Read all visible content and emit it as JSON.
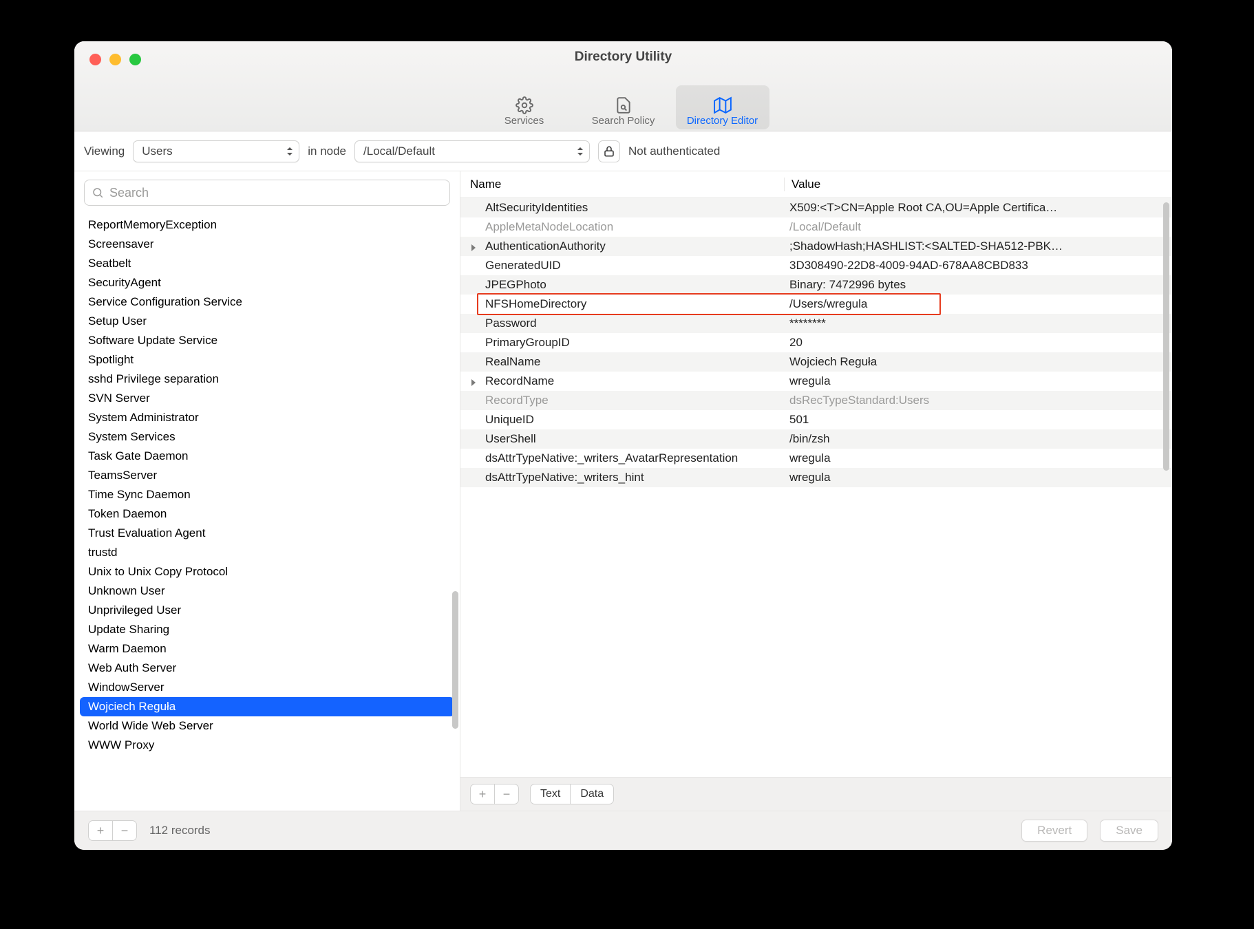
{
  "window_title": "Directory Utility",
  "toolbar": {
    "tabs": [
      {
        "label": "Services"
      },
      {
        "label": "Search Policy"
      },
      {
        "label": "Directory Editor",
        "active": true
      }
    ]
  },
  "filterbar": {
    "viewing_label": "Viewing",
    "viewing_value": "Users",
    "in_node_label": "in node",
    "in_node_value": "/Local/Default",
    "auth_status": "Not authenticated"
  },
  "search": {
    "placeholder": "Search"
  },
  "sidebar_items": [
    "ReportMemoryException",
    "Screensaver",
    "Seatbelt",
    "SecurityAgent",
    "Service Configuration Service",
    "Setup User",
    "Software Update Service",
    "Spotlight",
    "sshd Privilege separation",
    "SVN Server",
    "System Administrator",
    "System Services",
    "Task Gate Daemon",
    "TeamsServer",
    "Time Sync Daemon",
    "Token Daemon",
    "Trust Evaluation Agent",
    "trustd",
    "Unix to Unix Copy Protocol",
    "Unknown User",
    "Unprivileged User",
    "Update Sharing",
    "Warm Daemon",
    "Web Auth Server",
    "WindowServer",
    "Wojciech Reguła",
    "World Wide Web Server",
    "WWW Proxy"
  ],
  "sidebar_selected_index": 25,
  "table": {
    "header": {
      "name": "Name",
      "value": "Value"
    },
    "rows": [
      {
        "name": "AltSecurityIdentities",
        "value": "X509:<T>CN=Apple Root CA,OU=Apple Certifica…",
        "stripe": true
      },
      {
        "name": "AppleMetaNodeLocation",
        "value": "/Local/Default",
        "dim": true
      },
      {
        "name": "AuthenticationAuthority",
        "value": ";ShadowHash;HASHLIST:<SALTED-SHA512-PBK…",
        "caret": true,
        "stripe": true
      },
      {
        "name": "GeneratedUID",
        "value": "3D308490-22D8-4009-94AD-678AA8CBD833"
      },
      {
        "name": "JPEGPhoto",
        "value": "Binary: 7472996 bytes",
        "stripe": true
      },
      {
        "name": "NFSHomeDirectory",
        "value": "/Users/wregula",
        "highlight": true
      },
      {
        "name": "Password",
        "value": "********",
        "stripe": true
      },
      {
        "name": "PrimaryGroupID",
        "value": "20"
      },
      {
        "name": "RealName",
        "value": "Wojciech Reguła",
        "stripe": true
      },
      {
        "name": "RecordName",
        "value": "wregula",
        "caret": true
      },
      {
        "name": "RecordType",
        "value": "dsRecTypeStandard:Users",
        "dim": true,
        "stripe": true
      },
      {
        "name": "UniqueID",
        "value": "501"
      },
      {
        "name": "UserShell",
        "value": "/bin/zsh",
        "stripe": true
      },
      {
        "name": "dsAttrTypeNative:_writers_AvatarRepresentation",
        "value": "wregula"
      },
      {
        "name": "dsAttrTypeNative:_writers_hint",
        "value": "wregula",
        "stripe": true
      }
    ]
  },
  "detail_footer": {
    "segments": [
      "Text",
      "Data"
    ]
  },
  "bottombar": {
    "records_label": "112 records",
    "revert": "Revert",
    "save": "Save"
  }
}
